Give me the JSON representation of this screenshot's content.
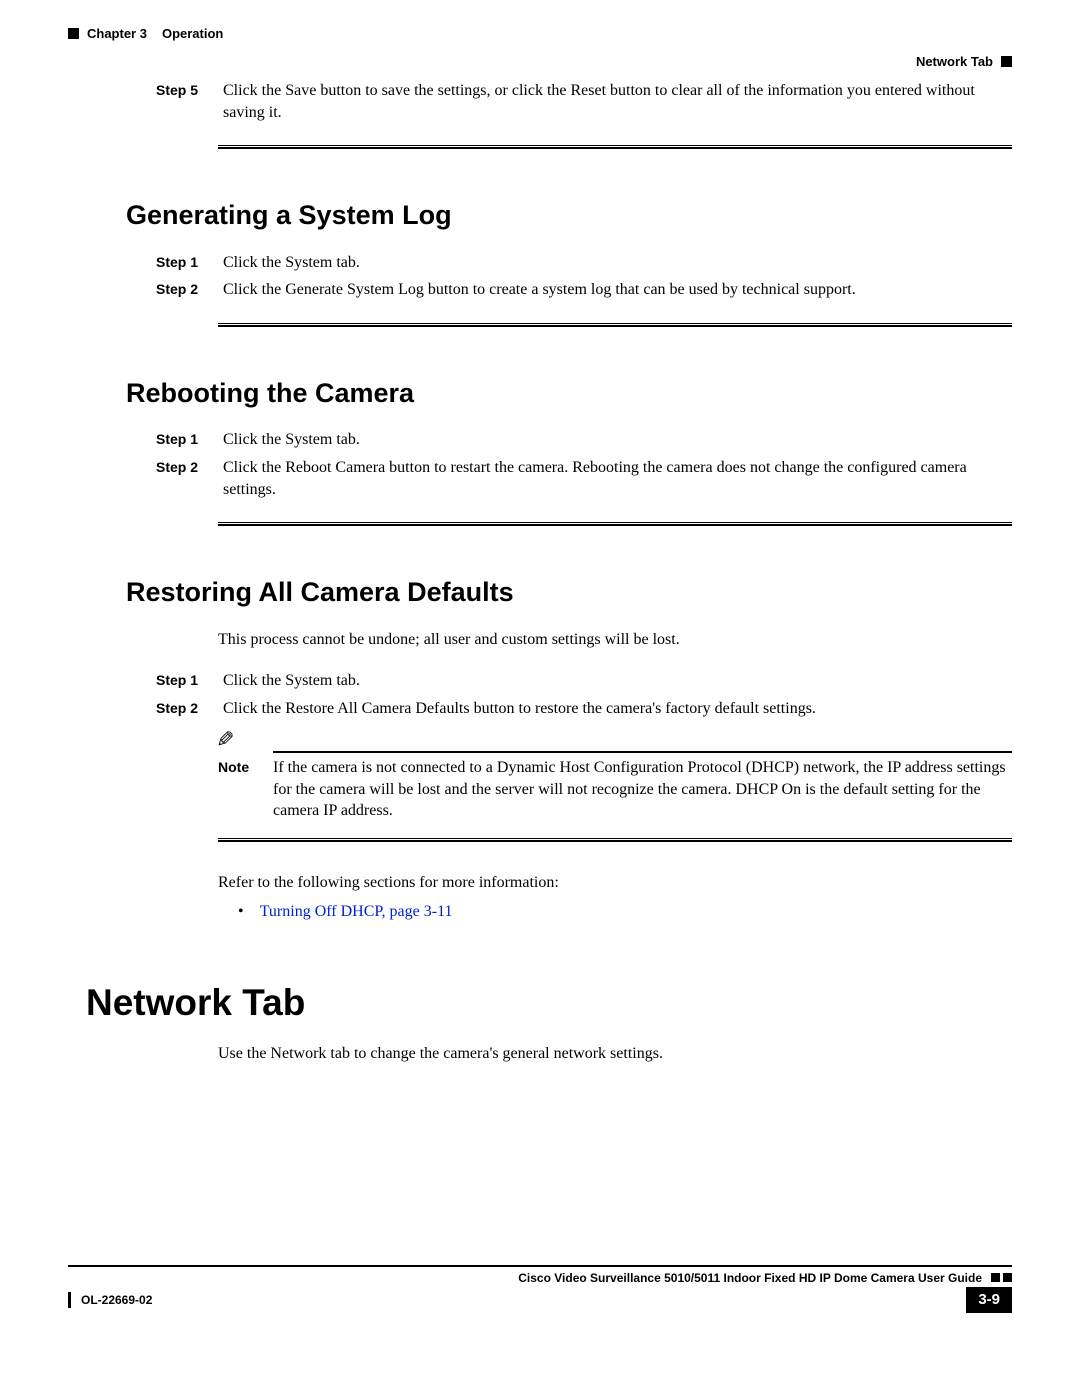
{
  "header": {
    "chapter": "Chapter 3",
    "chapter_title": "Operation",
    "right_label": "Network Tab"
  },
  "block1": {
    "step5_label": "Step 5",
    "step5_text": "Click the Save button to save the settings, or click the Reset button to clear all of the information you entered without saving it."
  },
  "section1": {
    "heading": "Generating a System Log",
    "step1_label": "Step 1",
    "step1_text": "Click the System tab.",
    "step2_label": "Step 2",
    "step2_text": "Click the Generate System Log button to create a system log that can be used by technical support."
  },
  "section2": {
    "heading": "Rebooting the Camera",
    "step1_label": "Step 1",
    "step1_text": "Click the System tab.",
    "step2_label": "Step 2",
    "step2_text": "Click the Reboot Camera button to restart the camera. Rebooting the camera does not change the configured camera settings."
  },
  "section3": {
    "heading": "Restoring All Camera Defaults",
    "intro": "This process cannot be undone; all user and custom settings will be lost.",
    "step1_label": "Step 1",
    "step1_text": "Click the System tab.",
    "step2_label": "Step 2",
    "step2_text": "Click the Restore All Camera Defaults button to restore the camera's factory default settings.",
    "note_label": "Note",
    "note_text": "If the camera is not connected to a Dynamic Host Configuration Protocol (DHCP) network, the IP address settings for the camera will be lost and the server will not recognize the camera. DHCP On is the default setting for the camera IP address.",
    "refer_text": "Refer to the following sections for more information:",
    "bullet1": "Turning Off DHCP, page 3-11"
  },
  "section4": {
    "heading": "Network Tab",
    "intro": "Use the Network tab to change the camera's general network settings."
  },
  "footer": {
    "guide_title": "Cisco Video Surveillance 5010/5011 Indoor Fixed HD IP Dome Camera User Guide",
    "doc_id": "OL-22669-02",
    "page_number": "3-9"
  }
}
